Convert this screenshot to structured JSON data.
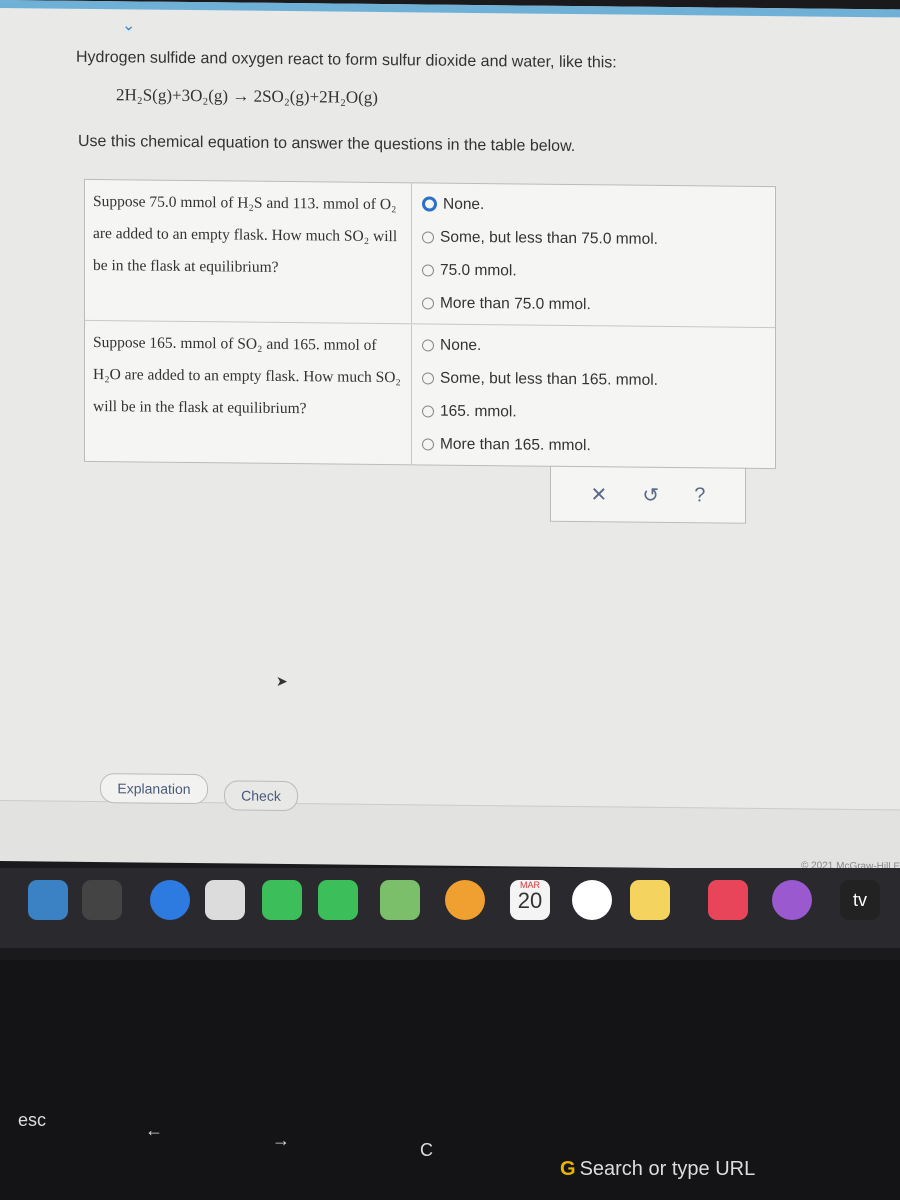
{
  "intro": "Hydrogen sulfide and oxygen react to form sulfur dioxide and water, like this:",
  "equation": "2H₂S(g)+3O₂(g) → 2SO₂(g)+2H₂O(g)",
  "instruction": "Use this chemical equation to answer the questions in the table below.",
  "questions": [
    {
      "text": "Suppose 75.0 mmol of H₂S and 113. mmol of O₂ are added to an empty flask. How much SO₂ will be in the flask at equilibrium?",
      "options": [
        "None.",
        "Some, but less than 75.0 mmol.",
        "75.0 mmol.",
        "More than 75.0 mmol."
      ],
      "selected": 0
    },
    {
      "text": "Suppose 165. mmol of SO₂ and 165. mmol of H₂O are added to an empty flask. How much SO₂ will be in the flask at equilibrium?",
      "options": [
        "None.",
        "Some, but less than 165. mmol.",
        "165. mmol.",
        "More than 165. mmol."
      ],
      "selected": null
    }
  ],
  "tools": {
    "clear": "✕",
    "undo": "↺",
    "help": "?"
  },
  "buttons": {
    "explanation": "Explanation",
    "check": "Check"
  },
  "copyright": "© 2021 McGraw-Hill E",
  "dock": {
    "calendar_month": "MAR",
    "calendar_day": "20",
    "tv": "tv"
  },
  "keyboard": {
    "esc": "esc",
    "back": "←",
    "forward": "→",
    "reload": "C"
  },
  "search_bar": "Search or type URL"
}
